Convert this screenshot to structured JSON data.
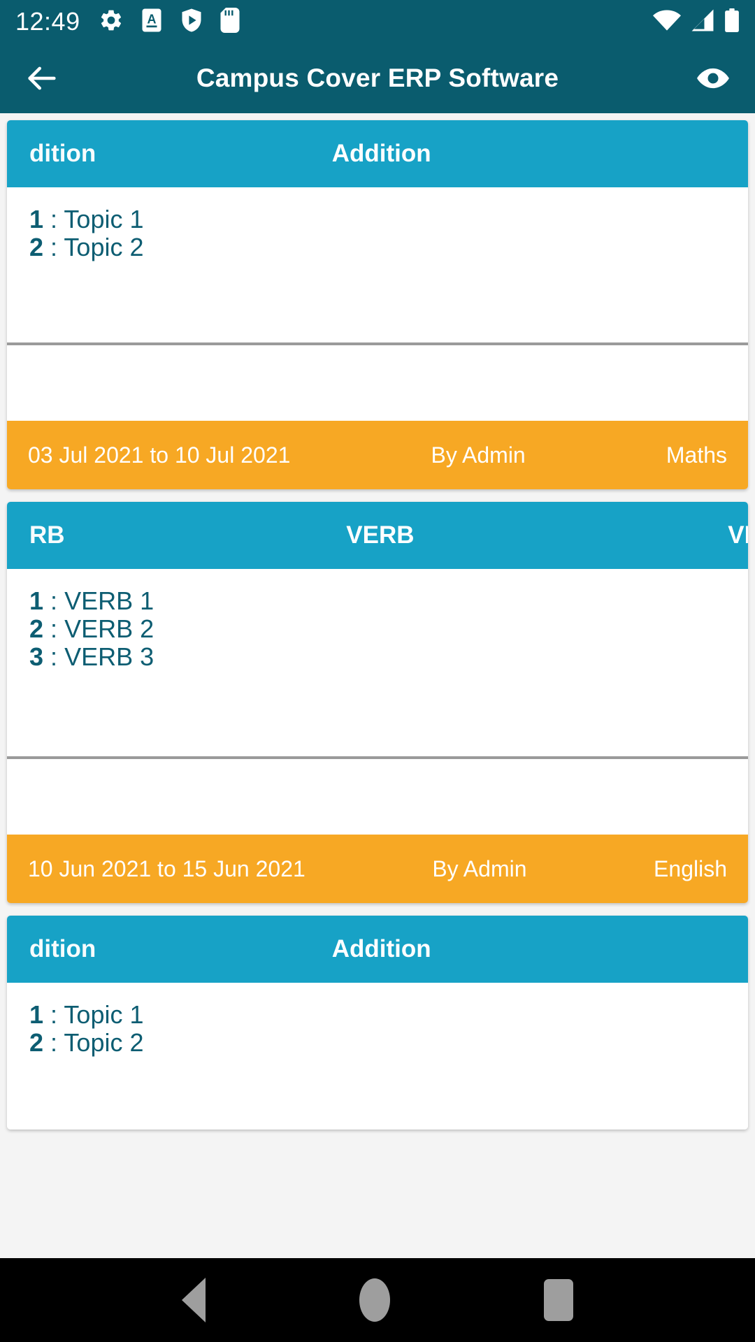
{
  "status_bar": {
    "time": "12:49",
    "left_icons": [
      "gear-icon",
      "a-subtitle-icon",
      "shield-play-icon",
      "sd-card-icon"
    ],
    "right_icons": [
      "wifi-icon",
      "signal-icon",
      "battery-icon"
    ],
    "background": "#0a5c6e"
  },
  "app_bar": {
    "title": "Campus Cover ERP Software",
    "back_icon": "arrow-left-icon",
    "action_icon": "eye-icon",
    "background": "#0a5c6e"
  },
  "theme": {
    "card_header_bg": "#17a2c6",
    "card_footer_bg": "#f7a824",
    "topic_text": "#0d5d72",
    "divider": "#9a9a9a",
    "page_bg": "#f4f4f4"
  },
  "cards": [
    {
      "header": {
        "marquee_left": "dition",
        "marquee_center": "Addition",
        "marquee_right": ""
      },
      "topics": [
        {
          "index": "1",
          "sep": ":",
          "label": "Topic 1"
        },
        {
          "index": "2",
          "sep": ":",
          "label": "Topic 2"
        }
      ],
      "footer": {
        "date_range": "03 Jul 2021 to 10 Jul 2021",
        "author": "By Admin",
        "subject": "Maths"
      }
    },
    {
      "header": {
        "marquee_left": "RB",
        "marquee_center": "VERB",
        "marquee_right": "VE"
      },
      "topics": [
        {
          "index": "1",
          "sep": ":",
          "label": "VERB 1"
        },
        {
          "index": "2",
          "sep": ":",
          "label": "VERB 2"
        },
        {
          "index": "3",
          "sep": ":",
          "label": "VERB 3"
        }
      ],
      "footer": {
        "date_range": "10 Jun 2021 to 15 Jun 2021",
        "author": "By Admin",
        "subject": "English"
      }
    },
    {
      "header": {
        "marquee_left": "dition",
        "marquee_center": "Addition",
        "marquee_right": ""
      },
      "topics": [
        {
          "index": "1",
          "sep": ":",
          "label": "Topic 1"
        },
        {
          "index": "2",
          "sep": ":",
          "label": "Topic 2"
        }
      ],
      "footer": {
        "date_range": "",
        "author": "",
        "subject": ""
      }
    }
  ],
  "nav_bar": {
    "back": "back-triangle-icon",
    "home": "home-circle-icon",
    "recents": "recents-square-icon"
  }
}
